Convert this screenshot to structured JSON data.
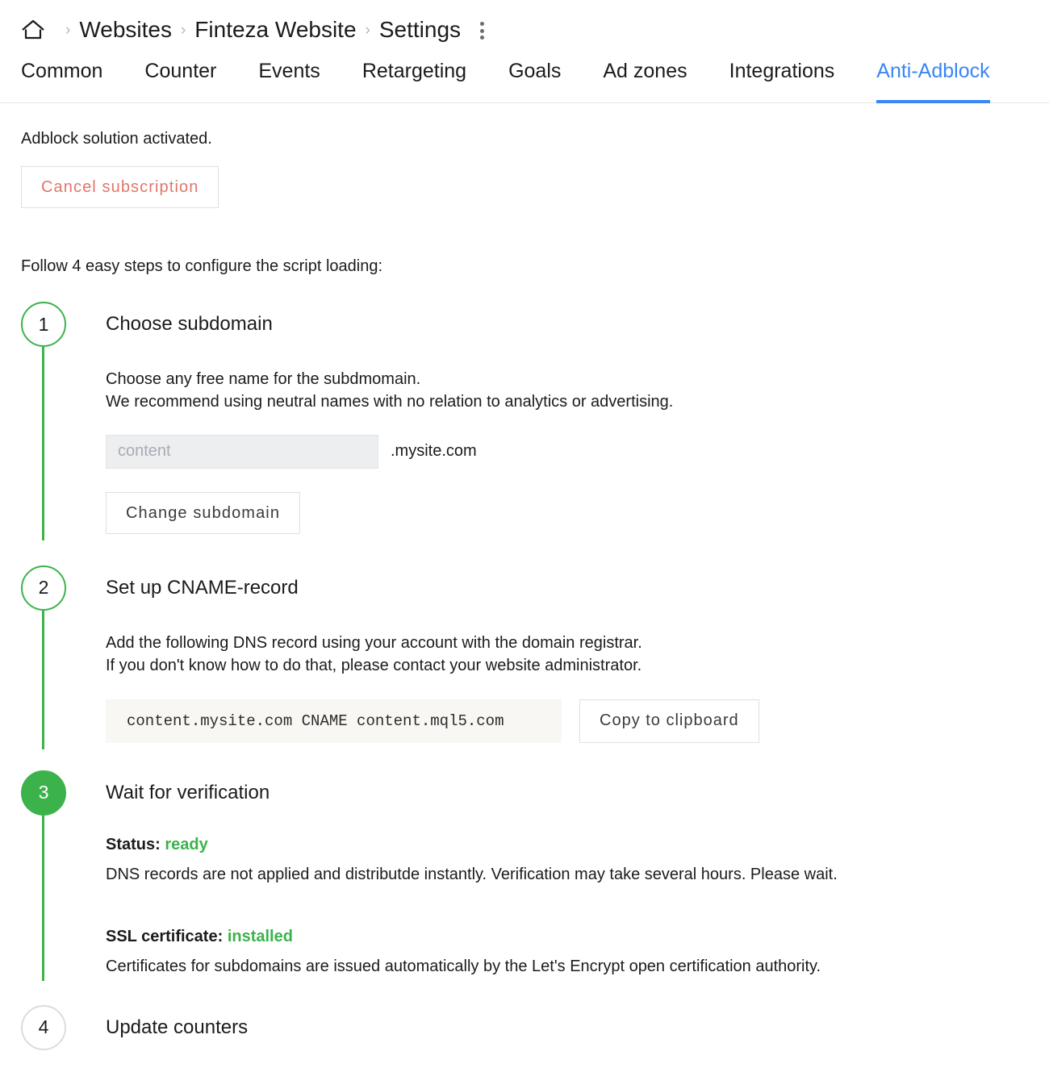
{
  "breadcrumb": {
    "home_icon": "home-icon",
    "separator": "›",
    "items": [
      "Websites",
      "Finteza Website",
      "Settings"
    ],
    "menu_icon": "kebab-menu-icon"
  },
  "tabs": {
    "items": [
      {
        "label": "Common",
        "active": false
      },
      {
        "label": "Counter",
        "active": false
      },
      {
        "label": "Events",
        "active": false
      },
      {
        "label": "Retargeting",
        "active": false
      },
      {
        "label": "Goals",
        "active": false
      },
      {
        "label": "Ad zones",
        "active": false
      },
      {
        "label": "Integrations",
        "active": false
      },
      {
        "label": "Anti-Adblock",
        "active": true
      }
    ],
    "active_color": "#3a86f5"
  },
  "main": {
    "notice": "Adblock solution activated.",
    "cancel_button": "Cancel subscription",
    "follow_text": "Follow 4 easy steps to configure the script loading:"
  },
  "steps": [
    {
      "number": "1",
      "title": "Choose subdomain",
      "desc_line1": "Choose any free name for the subdmomain.",
      "desc_line2": "We recommend using neutral names with no relation to analytics or advertising.",
      "input_placeholder": "content",
      "input_value": "",
      "domain_suffix": ".mysite.com",
      "button": "Change subdomain",
      "state": "outline-green"
    },
    {
      "number": "2",
      "title": "Set up CNAME-record",
      "desc_line1": "Add the following DNS record using your account with the domain registrar.",
      "desc_line2": "If you don't know how to do that, please contact your website administrator.",
      "dns_record": "content.mysite.com CNAME content.mql5.com",
      "copy_button": "Copy to clipboard",
      "state": "outline-green"
    },
    {
      "number": "3",
      "title": "Wait for verification",
      "status_label": "Status:",
      "status_value": "ready",
      "status_desc": "DNS records are not applied and distributde instantly. Verification may take several hours. Please wait.",
      "ssl_label": "SSL certificate:",
      "ssl_value": "installed",
      "ssl_desc": "Certificates for subdomains are issued automatically by the Let's Encrypt open certification authority.",
      "state": "filled-green"
    },
    {
      "number": "4",
      "title": "Update counters",
      "state": "outline-gray"
    }
  ],
  "colors": {
    "green": "#3cb34a",
    "blue": "#3a86f5",
    "red": "#e2766a",
    "gray_border": "#dcdcdc"
  }
}
